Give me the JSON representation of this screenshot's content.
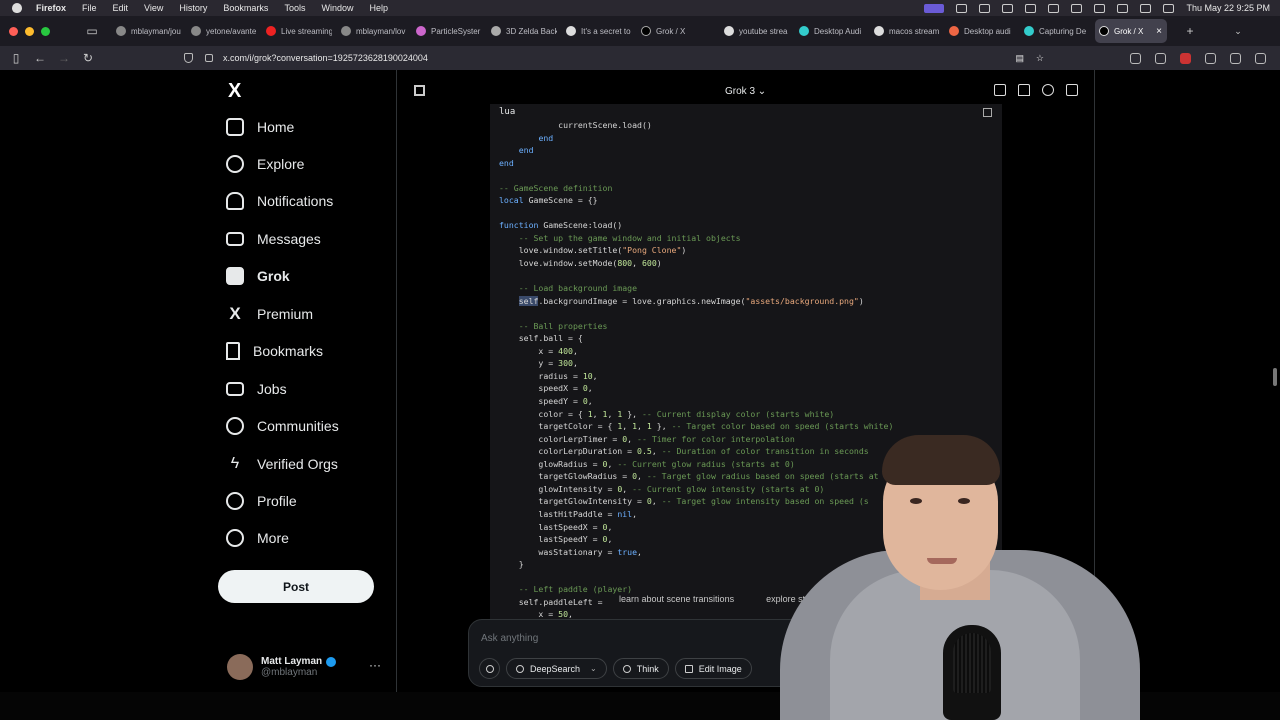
{
  "menubar": {
    "items": [
      "Firefox",
      "File",
      "Edit",
      "View",
      "History",
      "Bookmarks",
      "Tools",
      "Window",
      "Help"
    ],
    "datetime": "Thu May 22  9:25 PM"
  },
  "tabs": [
    {
      "label": "mblayman/jou"
    },
    {
      "label": "yetone/avante"
    },
    {
      "label": "Live streaming"
    },
    {
      "label": "mblayman/lov"
    },
    {
      "label": "ParticleSyster"
    },
    {
      "label": "3D Zelda Back"
    },
    {
      "label": "It's a secret to"
    },
    {
      "label": "Grok / X"
    },
    {
      "label": "youtube strea"
    },
    {
      "label": "Desktop Audi"
    },
    {
      "label": "macos stream"
    },
    {
      "label": "Desktop audi"
    },
    {
      "label": "Capturing De"
    },
    {
      "label": "Grok / X"
    }
  ],
  "url": "x.com/i/grok?conversation=1925723628190024004",
  "colors": {
    "bg": "#000000",
    "accent": "#1d9bf0",
    "code_bg": "#151518"
  },
  "sidebar": {
    "logo": "X",
    "items": [
      {
        "label": "Home",
        "icon": "home-icon"
      },
      {
        "label": "Explore",
        "icon": "search-icon"
      },
      {
        "label": "Notifications",
        "icon": "bell-icon"
      },
      {
        "label": "Messages",
        "icon": "envelope-icon"
      },
      {
        "label": "Grok",
        "icon": "grok-icon"
      },
      {
        "label": "Premium",
        "icon": "x-icon"
      },
      {
        "label": "Bookmarks",
        "icon": "bookmark-icon"
      },
      {
        "label": "Jobs",
        "icon": "briefcase-icon"
      },
      {
        "label": "Communities",
        "icon": "people-icon"
      },
      {
        "label": "Verified Orgs",
        "icon": "lightning-icon"
      },
      {
        "label": "Profile",
        "icon": "person-icon"
      },
      {
        "label": "More",
        "icon": "more-circle-icon"
      }
    ],
    "post_label": "Post",
    "profile": {
      "name": "Matt Layman",
      "handle": "@mblayman"
    }
  },
  "grok": {
    "model": "Grok 3",
    "code_lang": "lua",
    "suggestions": [
      "learn about scene transitions",
      "explore state machines"
    ],
    "input_placeholder": "Ask anything",
    "tools": {
      "deepsearch": "DeepSearch",
      "think": "Think",
      "edit_image": "Edit Image"
    }
  }
}
